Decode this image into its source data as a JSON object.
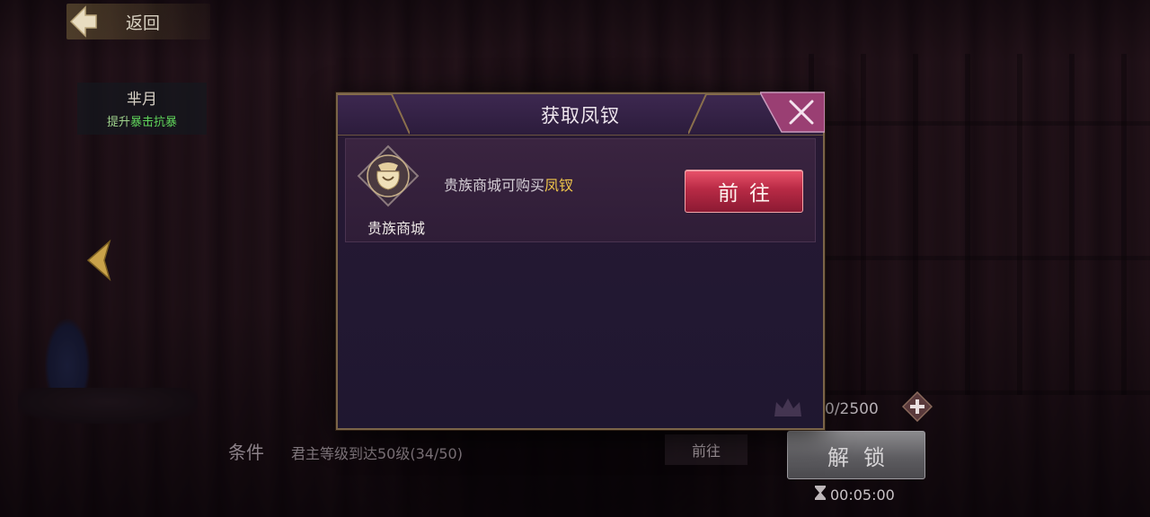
{
  "topbar": {
    "back_label": "返回"
  },
  "info_panel": {
    "name": "芈月",
    "desc_prefix": "提升",
    "desc_highlight": "暴击抗暴"
  },
  "modal": {
    "title": "获取凤钗",
    "source": {
      "name": "贵族商城",
      "desc_prefix": "贵族商城可购买",
      "desc_highlight": "凤钗",
      "button_label": "前往"
    }
  },
  "bottom": {
    "condition_label": "条件",
    "condition_text": "君主等级到达50级(34/50)",
    "goto_label": "前往",
    "count": "0/2500",
    "unlock_label": "解锁",
    "timer": "00:05:00"
  },
  "colors": {
    "accent_gold": "#f0c64a",
    "goto_red": "#b82a45",
    "highlight_green": "#5fd35a"
  }
}
